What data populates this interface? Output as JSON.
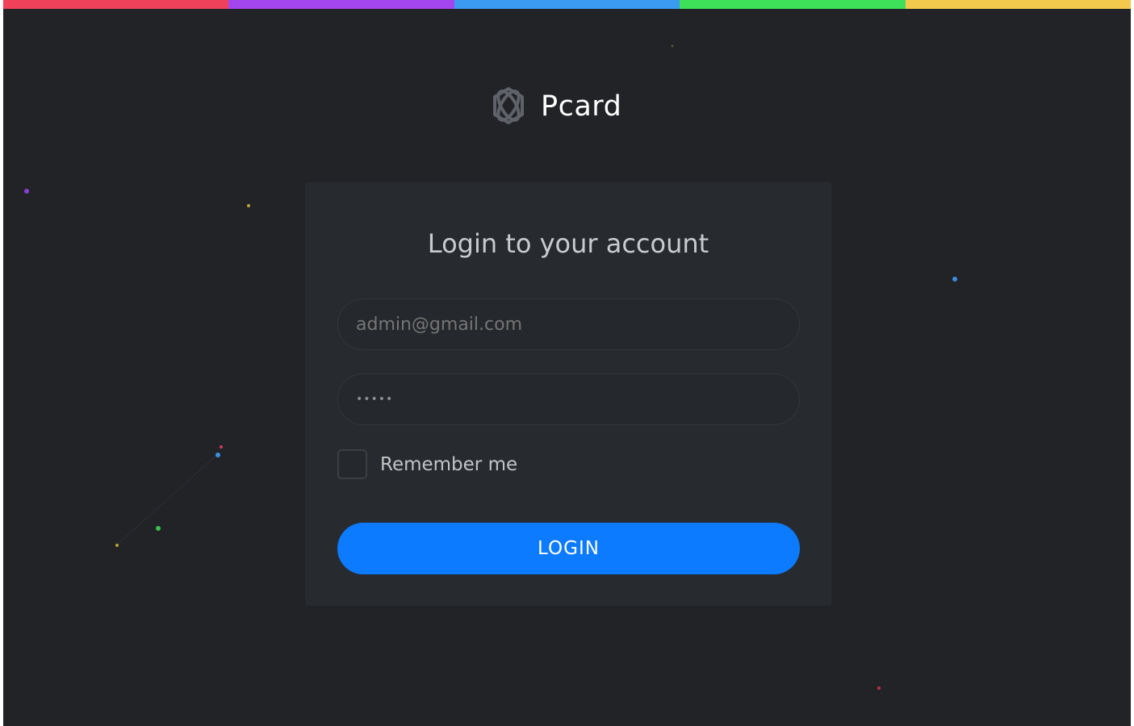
{
  "topbar": {
    "colors": [
      "#f0415a",
      "#a346f0",
      "#3a9bf0",
      "#3ee05a",
      "#f2c94c"
    ]
  },
  "brand": {
    "logo_icon": "atom-hexagon-icon",
    "name": "Pcard"
  },
  "login_form": {
    "title": "Login to your account",
    "email": {
      "placeholder": "admin@gmail.com",
      "value": ""
    },
    "password": {
      "value": "•••••"
    },
    "remember_label": "Remember me",
    "remember_checked": false,
    "submit_label": "LOGIN"
  },
  "colors": {
    "background": "#212327",
    "card": "#272a2e",
    "accent": "#0d7bff"
  }
}
